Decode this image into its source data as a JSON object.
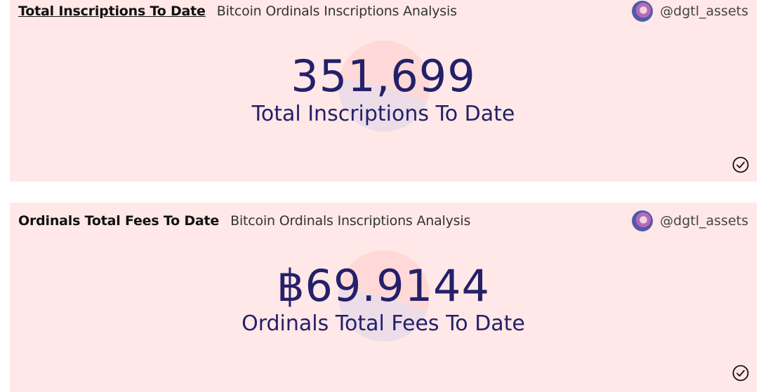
{
  "cards": [
    {
      "title": "Total Inscriptions To Date",
      "subtitle": "Bitcoin Ordinals Inscriptions Analysis",
      "author": "@dgtl_assets",
      "value": "351,699",
      "label": "Total Inscriptions To Date"
    },
    {
      "title": "Ordinals Total Fees To Date",
      "subtitle": "Bitcoin Ordinals Inscriptions Analysis",
      "author": "@dgtl_assets",
      "value": "฿69.9144",
      "label": "Ordinals Total Fees To Date"
    }
  ],
  "icons": {
    "avatar": "user-avatar",
    "check": "check-circle-icon",
    "watermark": "dashboard-logo-watermark"
  },
  "colors": {
    "card_background": "#ffe8e7",
    "counter_text": "#24206a"
  }
}
